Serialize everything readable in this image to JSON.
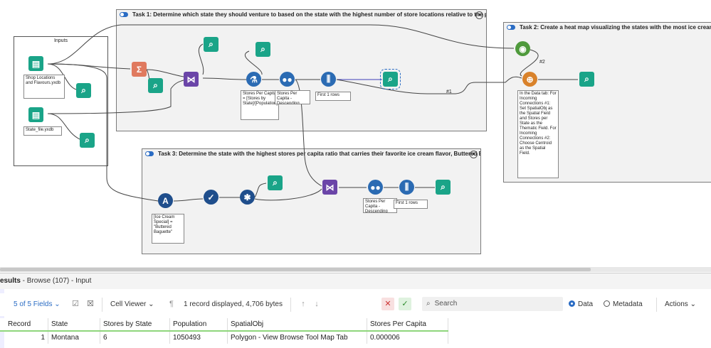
{
  "containers": {
    "inputs": {
      "title": "Inputs"
    },
    "task1": {
      "title": "Task 1: Determine which state they should venture to based on the state with the highest number of store locations relative to the population."
    },
    "task2": {
      "title": "Task 2: Create a heat map visualizing the states with the most ice cream shops."
    },
    "task3": {
      "title": "Task 3: Determine the state with the highest stores per capita ratio that carries their favorite ice cream flavor, Buttered Baguette."
    }
  },
  "annotations": {
    "input1": "Shop Locations and Flavours.yxdb",
    "input2": "State_file.yxdb",
    "formula1": "Stores Per Capita = [Stores by State]/[Population]",
    "sort1": "Stores Per Capita - Descending",
    "sample1": "First 1 rows",
    "filter3": "[Ice Cream Special] = \"Buttered Baguette\"",
    "sort3": "Stores Per Capita - Descending",
    "sample3": "First 1 rows",
    "report_map": "In the Data tab: For Incoming Connections #1: Set SpatialObj as the Spatial Field and Stores per State as the Thematic Field. For Incoming Connections #2: Choose Centroid as the Spatial Field.",
    "wire1": "#1",
    "wire2": "#2"
  },
  "results": {
    "title_prefix": "esults",
    "title_suffix": " - Browse (107) - Input"
  },
  "toolbar": {
    "fields": "5 of 5 Fields",
    "cell_viewer": "Cell Viewer",
    "record_info": "1 record displayed, 4,706 bytes",
    "search_placeholder": "Search",
    "data_label": "Data",
    "metadata_label": "Metadata",
    "actions_label": "Actions"
  },
  "table": {
    "columns": [
      "Record",
      "State",
      "Stores by State",
      "Population",
      "SpatialObj",
      "Stores Per Capita"
    ],
    "rows": [
      [
        "1",
        "Montana",
        "6",
        "1050493",
        "Polygon - View Browse Tool Map Tab",
        "0.000006"
      ]
    ]
  },
  "colors": {
    "accent": "#2a6cc4",
    "browse_tool": "#1aa488",
    "header_underline": "#8fd67c"
  }
}
